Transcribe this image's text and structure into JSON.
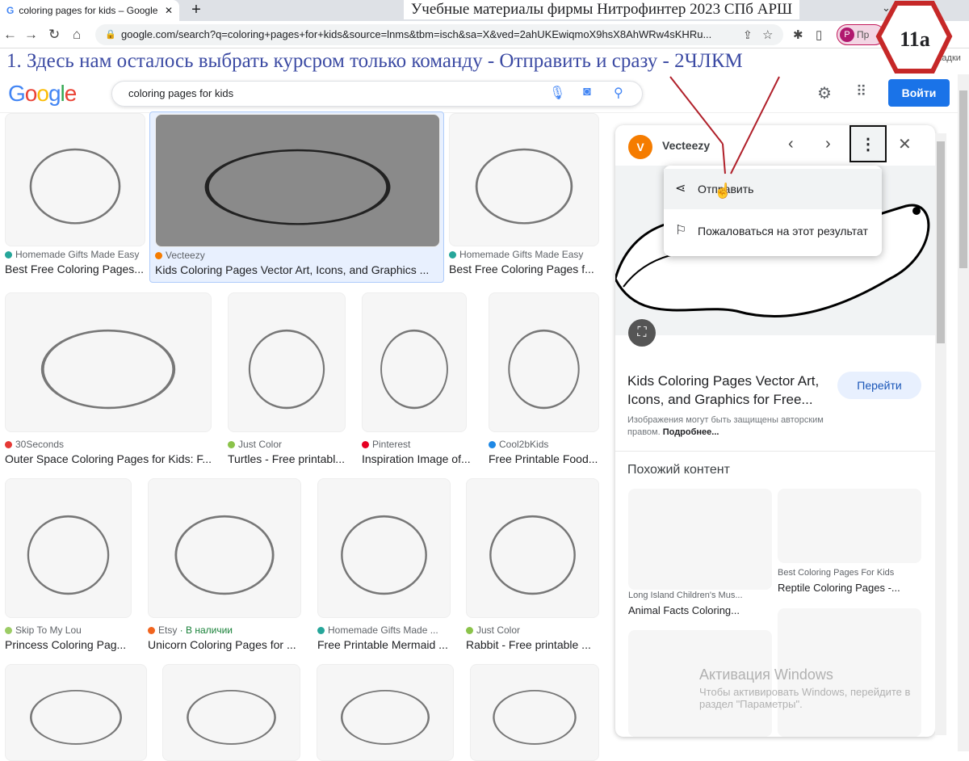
{
  "browser": {
    "tab_title": "coloring pages for kids – Google",
    "new_tab": "+",
    "url": "google.com/search?q=coloring+pages+for+kids&source=lnms&tbm=isch&sa=X&ved=2ahUKEwiqmoX9hsX8AhWRw4sKHRu...",
    "profile_initial": "P",
    "profile_label": "Пр",
    "bookmarks_label": "ладки"
  },
  "annotation": {
    "document_title": "Учебные материалы фирмы Нитрофинтер 2023 СПб АРШ",
    "instruction": "1. Здесь нам осталось выбрать курсром только команду - Отправить и сразу - 2ЧЛКМ",
    "step_badge": "11a",
    "arrow_color": "#b0202a"
  },
  "google": {
    "logo": "Google",
    "query": "coloring pages for kids",
    "signin": "Войти"
  },
  "results": [
    {
      "source": "Homemade Gifts Made Easy",
      "title": "Best Free Coloring Pages...",
      "color": "#26a69a"
    },
    {
      "source": "Vecteezy",
      "title": "Kids Coloring Pages Vector Art, Icons, and Graphics ...",
      "color": "#f57c00",
      "selected": true
    },
    {
      "source": "Homemade Gifts Made Easy",
      "title": "Best Free Coloring Pages f...",
      "color": "#26a69a"
    },
    {
      "source": "30Seconds",
      "title": "Outer Space Coloring Pages for Kids: F...",
      "color": "#e53935"
    },
    {
      "source": "Just Color",
      "title": "Turtles - Free printabl...",
      "color": "#8bc34a"
    },
    {
      "source": "Pinterest",
      "title": "Inspiration Image of...",
      "color": "#e60023"
    },
    {
      "source": "Cool2bKids",
      "title": "Free Printable Food...",
      "color": "#1e88e5"
    },
    {
      "source": "Skip To My Lou",
      "title": "Princess Coloring Pag...",
      "color": "#9ccc65"
    },
    {
      "source": "Etsy",
      "source_extra": " · В наличии",
      "title": "Unicorn Coloring Pages for ...",
      "color": "#f1641e"
    },
    {
      "source": "Homemade Gifts Made ...",
      "title": "Free Printable Mermaid ...",
      "color": "#26a69a"
    },
    {
      "source": "Just Color",
      "title": "Rabbit - Free printable ...",
      "color": "#8bc34a"
    },
    {
      "source": "",
      "title": ""
    },
    {
      "source": "",
      "title": ""
    },
    {
      "source": "",
      "title": ""
    },
    {
      "source": "",
      "title": ""
    }
  ],
  "panel": {
    "source": "Vecteezy",
    "title": "Kids Coloring Pages Vector Art, Icons, and Graphics for Free...",
    "goto": "Перейти",
    "copyright": "Изображения могут быть защищены авторским правом.",
    "more": "Подробнее...",
    "similar_heading": "Похожий контент",
    "similar": [
      {
        "source": "Long Island Children's Mus...",
        "title": "Animal Facts Coloring..."
      },
      {
        "source": "Best Coloring Pages For Kids",
        "title": "Reptile Coloring Pages -..."
      }
    ],
    "menu": [
      {
        "label": "Отправить",
        "icon": "share-icon"
      },
      {
        "label": "Пожаловаться на этот результат",
        "icon": "flag-icon"
      }
    ]
  },
  "os_watermark": {
    "title": "Активация Windows",
    "text": "Чтобы активировать Windows, перейдите в раздел \"Параметры\"."
  }
}
